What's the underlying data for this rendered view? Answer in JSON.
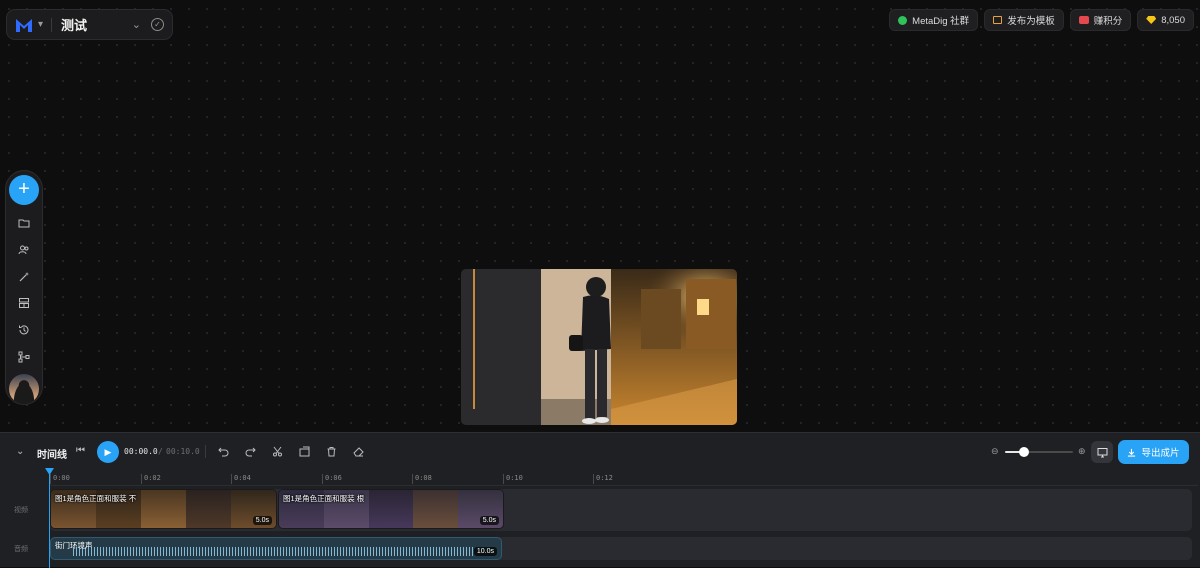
{
  "project": {
    "title": "测试"
  },
  "topbar": {
    "community_label": "MetaDig 社群",
    "template_label": "发布为模板",
    "points_label": "赚积分",
    "credits": "8,050"
  },
  "colors": {
    "accent": "#29a3f5",
    "background": "#0e0e0e",
    "panel": "#1f2024"
  },
  "rail": {
    "icons": [
      "plus-icon",
      "folder-icon",
      "users-icon",
      "magic-wand-icon",
      "layout-icon",
      "history-icon",
      "flow-icon",
      "avatar"
    ]
  },
  "timeline": {
    "title": "时间线",
    "current_time": "00:00.0",
    "separator": "/",
    "total_time": "00:10.0",
    "zoom_level": 0.28,
    "export_label": "导出成片",
    "ruler": [
      "0:00",
      "0:02",
      "0:04",
      "0:06",
      "0:08",
      "0:10",
      "0:12"
    ],
    "video_track_label": "视频",
    "audio_track_label": "音频",
    "clips": [
      {
        "label": "图1是角色正面和服装 不",
        "duration": "5.0s"
      },
      {
        "label": "图1是角色正面和服装 根",
        "duration": "5.0s"
      }
    ],
    "audio_clip": {
      "label": "街门环境声",
      "duration": "10.0s"
    }
  }
}
